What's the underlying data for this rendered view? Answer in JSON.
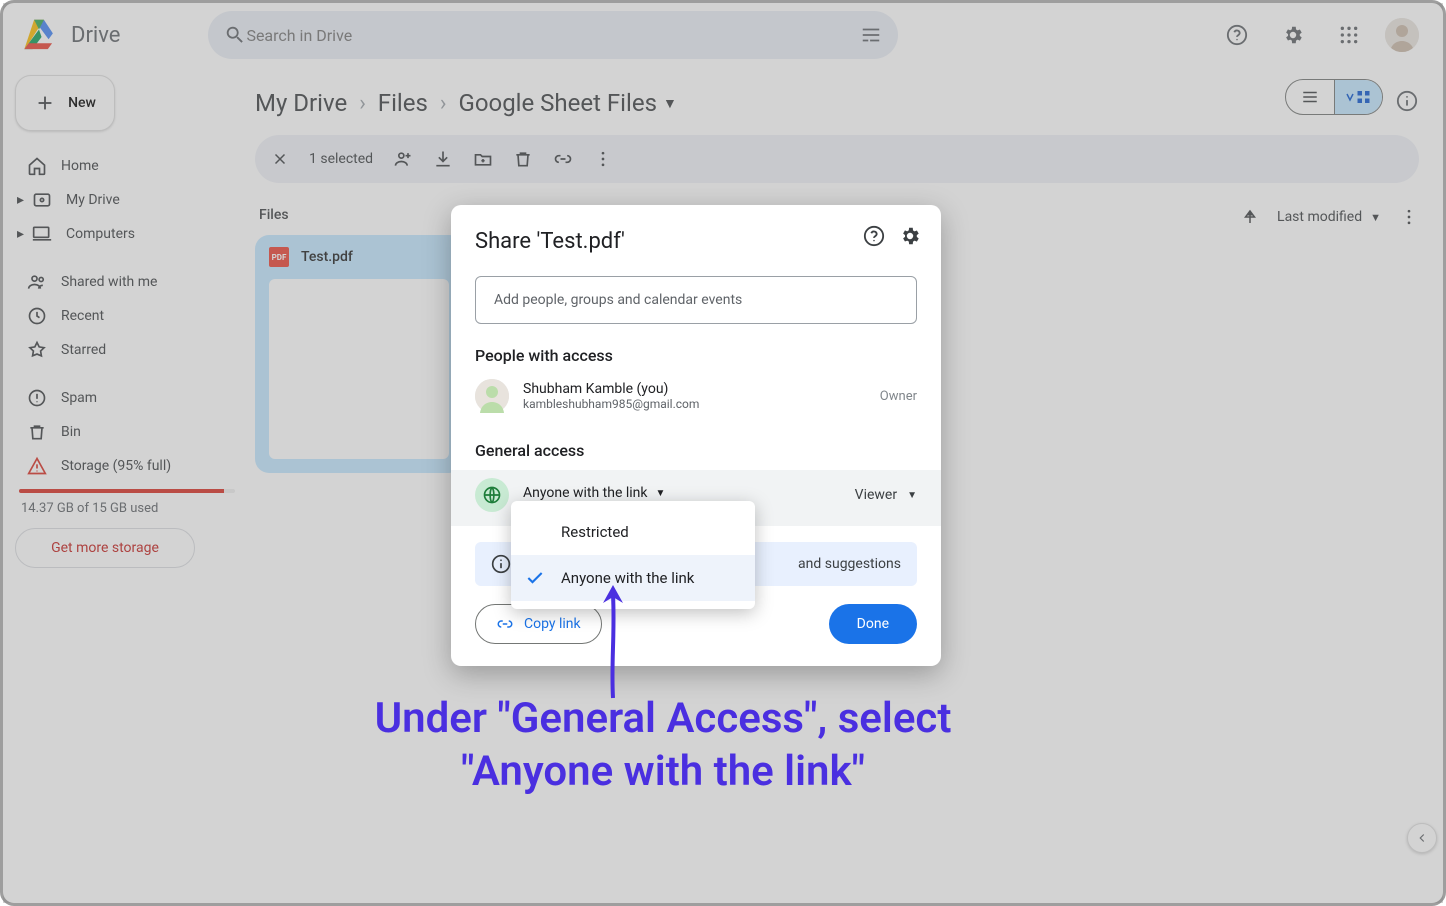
{
  "header": {
    "app_name": "Drive",
    "search_placeholder": "Search in Drive"
  },
  "sidebar": {
    "new_label": "New",
    "items": [
      {
        "label": "Home"
      },
      {
        "label": "My Drive"
      },
      {
        "label": "Computers"
      },
      {
        "label": "Shared with me"
      },
      {
        "label": "Recent"
      },
      {
        "label": "Starred"
      },
      {
        "label": "Spam"
      },
      {
        "label": "Bin"
      },
      {
        "label": "Storage (95% full)"
      }
    ],
    "storage_used_text": "14.37 GB of 15 GB used",
    "storage_percent": 95,
    "get_more": "Get more storage"
  },
  "breadcrumbs": [
    "My Drive",
    "Files",
    "Google Sheet Files"
  ],
  "selection_bar": {
    "count_text": "1 selected"
  },
  "files_section_label": "Files",
  "sort": {
    "label": "Last modified"
  },
  "file": {
    "name": "Test.pdf",
    "badge": "PDF"
  },
  "dialog": {
    "title": "Share 'Test.pdf'",
    "people_placeholder": "Add people, groups and calendar events",
    "people_with_access": "People with access",
    "person": {
      "name": "Shubham Kamble (you)",
      "email": "kambleshubham985@gmail.com",
      "role": "Owner"
    },
    "general_access": "General access",
    "ga_selected": "Anyone with the link",
    "role_selected": "Viewer",
    "info_tail": "and suggestions",
    "copy_link": "Copy link",
    "done": "Done"
  },
  "dropdown": {
    "options": [
      "Restricted",
      "Anyone with the link"
    ],
    "selected_index": 1
  },
  "annotation": {
    "line1": "Under \"General Access\", select",
    "line2": "\"Anyone with the link\""
  }
}
